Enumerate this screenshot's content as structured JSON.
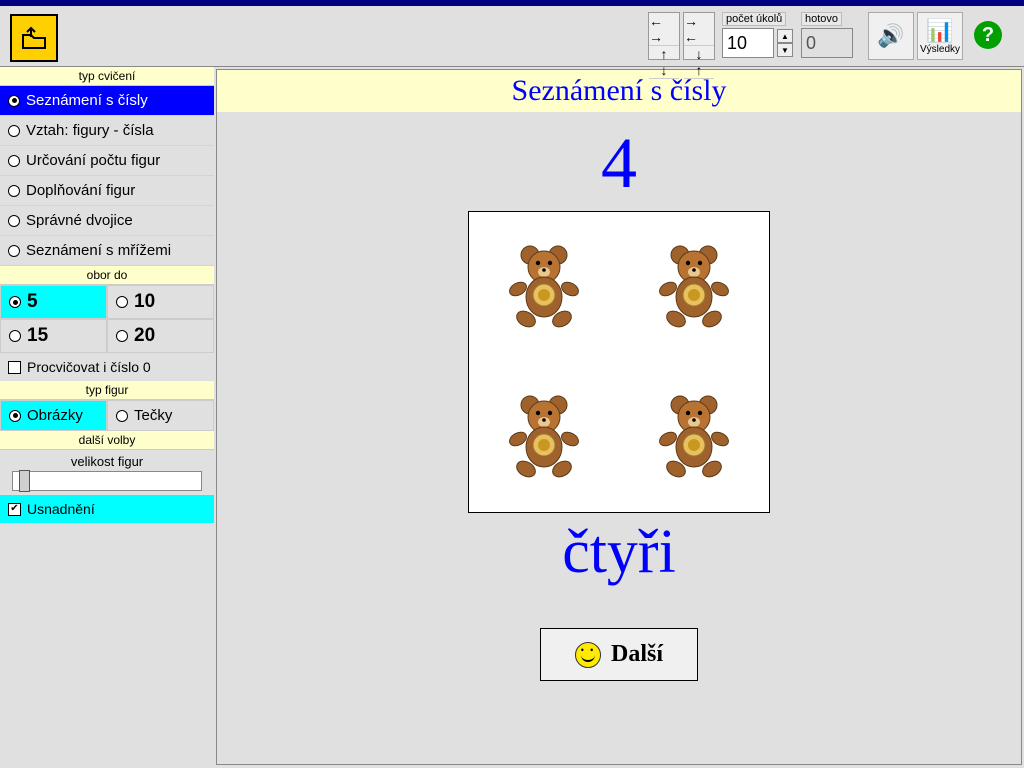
{
  "toolbar": {
    "tasks_label": "počet úkolů",
    "done_label": "hotovo",
    "tasks_value": "10",
    "done_value": "0",
    "results_label": "Výsledky"
  },
  "sidebar": {
    "type_title": "typ cvičení",
    "types": [
      "Seznámení s čísly",
      "Vztah: figury - čísla",
      "Určování počtu figur",
      "Doplňování figur",
      "Správné dvojice",
      "Seznámení s mřížemi"
    ],
    "selected_type": 0,
    "range_title": "obor do",
    "ranges": [
      "5",
      "10",
      "15",
      "20"
    ],
    "selected_range": 0,
    "practice_zero": "Procvičovat i číslo 0",
    "figtype_title": "typ figur",
    "figtypes": [
      "Obrázky",
      "Tečky"
    ],
    "selected_figtype": 0,
    "other_title": "další volby",
    "size_label": "velikost figur",
    "ease_label": "Usnadnění"
  },
  "main": {
    "title": "Seznámení s čísly",
    "number": "4",
    "word": "čtyři",
    "next": "Další",
    "figure_count": 4,
    "figure_item": "teddy-bear"
  }
}
